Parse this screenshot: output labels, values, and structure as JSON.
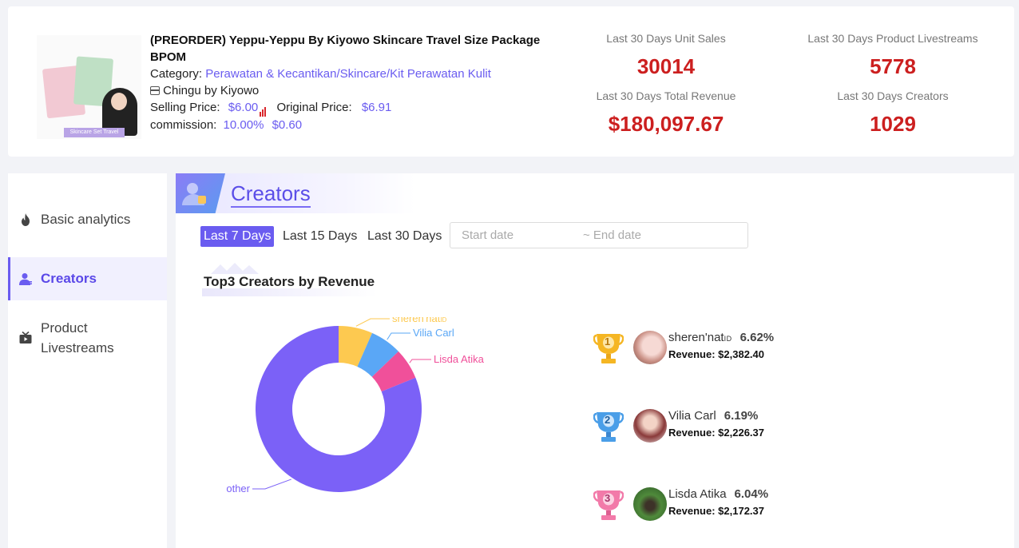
{
  "product": {
    "title": "(PREORDER) Yeppu-Yeppu By Kiyowo Skincare Travel Size Package BPOM",
    "category_label": "Category:",
    "category_value": "Perawatan & Kecantikan/Skincare/Kit Perawatan Kulit",
    "shop": "Chingu by Kiyowo",
    "selling_price_label": "Selling Price:",
    "selling_price": "$6.00",
    "original_price_label": "Original Price:",
    "original_price": "$6.91",
    "commission_label": "commission:",
    "commission_rate": "10.00%",
    "commission_amount": "$0.60",
    "thumb_band": "Skincare Set Travel Size"
  },
  "stats": [
    {
      "label": "Last 30 Days Unit Sales",
      "value": "30014"
    },
    {
      "label": "Last 30 Days Product Livestreams",
      "value": "5778"
    },
    {
      "label": "Last 30 Days Total Revenue",
      "value": "$180,097.67"
    },
    {
      "label": "Last 30 Days Creators",
      "value": "1029"
    }
  ],
  "sidebar": {
    "items": [
      {
        "label": "Basic analytics",
        "icon": "fire-icon"
      },
      {
        "label": "Creators",
        "icon": "user-icon"
      },
      {
        "label": "Product Livestreams",
        "icon": "tv-icon"
      }
    ]
  },
  "section": {
    "banner_title": "Creators",
    "ranges": [
      "Last 7 Days",
      "Last 15 Days",
      "Last 30 Days"
    ],
    "start_placeholder": "Start date",
    "end_placeholder": "~ End date",
    "chart_title": "Top3 Creators by Revenue"
  },
  "chart_data": {
    "type": "pie",
    "donut": true,
    "title": "Top3 Creators by Revenue",
    "slices": [
      {
        "name": "sheren'nat",
        "value": 6.62,
        "color": "#fdc950"
      },
      {
        "name": "Vilia Carl",
        "value": 6.19,
        "color": "#5aa7f6"
      },
      {
        "name": "Lisda Atika",
        "value": 6.04,
        "color": "#f0509a"
      },
      {
        "name": "other",
        "value": 81.15,
        "color": "#7b61f7"
      }
    ],
    "labels": [
      "sheren'nat",
      "Vilia Carl",
      "Lisda Atika",
      "other"
    ],
    "label_id_badge": "ID"
  },
  "ranking": [
    {
      "rank": "1",
      "name": "sheren'nat",
      "badge": "ID",
      "percent": "6.62%",
      "revenue_label": "Revenue:",
      "revenue": "$2,382.40"
    },
    {
      "rank": "2",
      "name": "Vilia Carl",
      "badge": "",
      "percent": "6.19%",
      "revenue_label": "Revenue:",
      "revenue": "$2,226.37"
    },
    {
      "rank": "3",
      "name": "Lisda Atika",
      "badge": "",
      "percent": "6.04%",
      "revenue_label": "Revenue:",
      "revenue": "$2,172.37"
    }
  ],
  "colors": {
    "accent": "#6a5cf0",
    "stat_value": "#cc1f1f",
    "link": "#6a5cf0"
  }
}
